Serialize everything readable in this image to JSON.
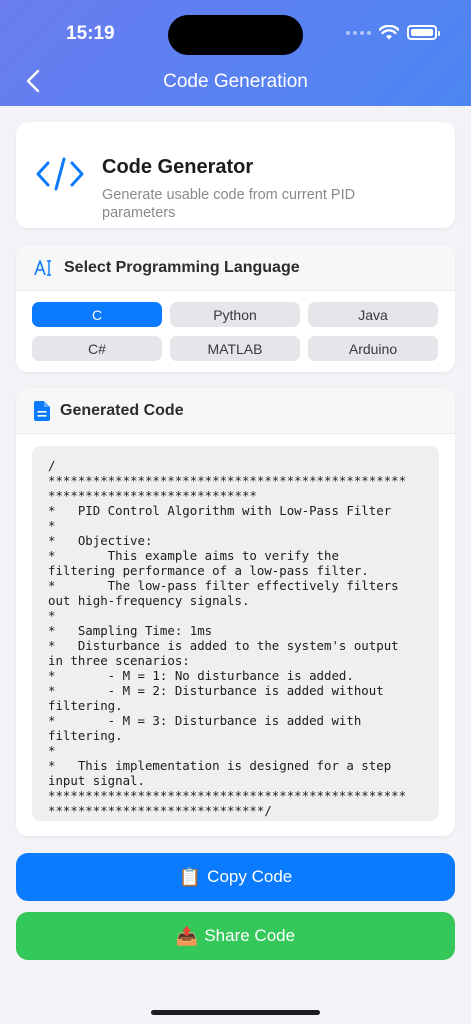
{
  "status_bar": {
    "time": "15:19"
  },
  "nav": {
    "title": "Code Generation",
    "back_icon": "chevron-left-icon"
  },
  "generator": {
    "icon": "code-brackets-icon",
    "title": "Code Generator",
    "subtitle": "Generate usable code from current PID parameters"
  },
  "language": {
    "icon": "text-cursor-icon",
    "title": "Select Programming Language",
    "selected": "C",
    "options": [
      "C",
      "Python",
      "Java",
      "C#",
      "MATLAB",
      "Arduino"
    ]
  },
  "code": {
    "icon": "document-icon",
    "title": "Generated Code",
    "content": "/\n************************************************\n****************************\n*   PID Control Algorithm with Low-Pass Filter\n*\n*   Objective:\n*       This example aims to verify the\nfiltering performance of a low-pass filter.\n*       The low-pass filter effectively filters\nout high-frequency signals.\n*\n*   Sampling Time: 1ms\n*   Disturbance is added to the system's output\nin three scenarios:\n*       - M = 1: No disturbance is added.\n*       - M = 2: Disturbance is added without\nfiltering.\n*       - M = 3: Disturbance is added with\nfiltering.\n*\n*   This implementation is designed for a step\ninput signal.\n************************************************\n*****************************/"
  },
  "actions": {
    "copy_emoji": "📋",
    "copy_label": "Copy Code",
    "share_emoji": "📤",
    "share_label": "Share Code"
  },
  "colors": {
    "accent": "#0a7aff",
    "share": "#34c759",
    "header_gradient_start": "#6a7cf0",
    "header_gradient_end": "#4c86f2"
  }
}
